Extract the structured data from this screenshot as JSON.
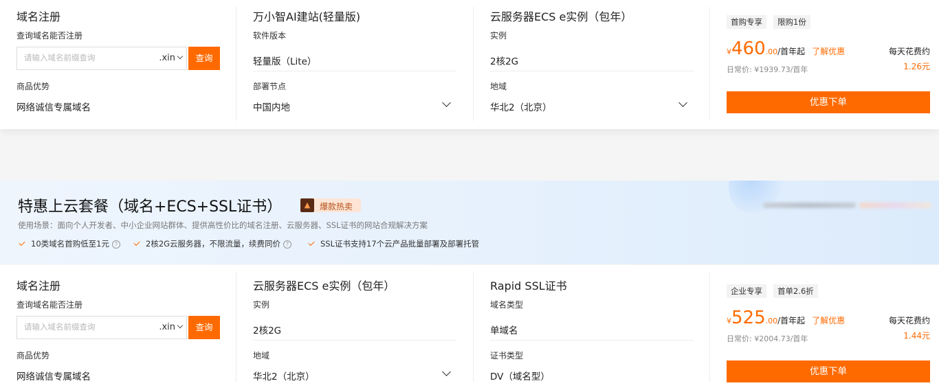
{
  "card1": {
    "domain": {
      "title": "域名注册",
      "query_label": "查询域名能否注册",
      "input_placeholder": "请输入域名前缀查询",
      "suffix": ".xin",
      "query_button": "查询",
      "advantage_label": "商品优势",
      "advantage_value": "网络诚信专属域名"
    },
    "col2": {
      "title": "万小智AI建站(轻量版)",
      "label1": "软件版本",
      "value1": "轻量版（Lite）",
      "label2": "部署节点",
      "value2": "中国内地"
    },
    "col3": {
      "title": "云服务器ECS e实例（包年）",
      "label1": "实例",
      "value1": "2核2G",
      "label2": "地域",
      "value2": "华北2（北京）"
    },
    "price": {
      "tag1": "首购专享",
      "tag2": "限购1份",
      "currency": "¥",
      "amount": "460",
      "decimal": ".00",
      "unit": "/首年起",
      "promo": "了解优惠",
      "normal_price": "日常价: ¥1939.73/首年",
      "daily_label": "每天花费约",
      "daily_value": "1.26元",
      "order_button": "优惠下单"
    }
  },
  "banner": {
    "title": "特惠上云套餐（域名+ECS+SSL证书）",
    "badge": "爆款热卖",
    "subtitle": "使用场景：面向个人开发者、中小企业网站群体、提供高性价比的域名注册、云服务器、SSL证书的网站合规解决方案",
    "features": [
      "10类域名首购低至1元",
      "2核2G云服务器，不限流量，续费同价",
      "SSL证书支持17个云产品批量部署及部署托管"
    ]
  },
  "card2": {
    "domain": {
      "title": "域名注册",
      "query_label": "查询域名能否注册",
      "input_placeholder": "请输入域名前缀查询",
      "suffix": ".xin",
      "query_button": "查询",
      "advantage_label": "商品优势",
      "advantage_value": "网络诚信专属域名"
    },
    "col2": {
      "title": "云服务器ECS e实例（包年）",
      "label1": "实例",
      "value1": "2核2G",
      "label2": "地域",
      "value2": "华北2（北京）"
    },
    "col3": {
      "title": "Rapid SSL证书",
      "label1": "域名类型",
      "value1": "单域名",
      "label2": "证书类型",
      "value2": "DV（域名型）"
    },
    "price": {
      "tag1": "企业专享",
      "tag2": "首单2.6折",
      "currency": "¥",
      "amount": "525",
      "decimal": ".00",
      "unit": "/首年起",
      "promo": "了解优惠",
      "normal_price": "日常价: ¥2004.73/首年",
      "daily_label": "每天花费约",
      "daily_value": "1.44元",
      "order_button": "优惠下单"
    }
  }
}
